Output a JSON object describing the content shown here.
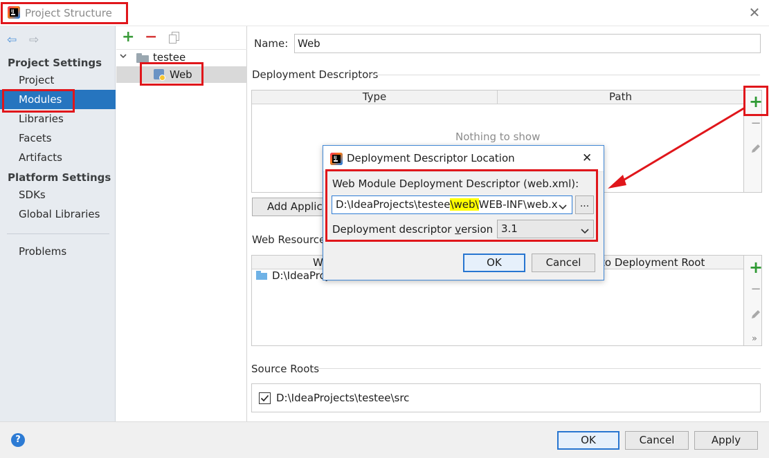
{
  "window": {
    "title": "Project Structure",
    "close_glyph": "✕"
  },
  "sidebar": {
    "back_glyph": "⇦",
    "forward_glyph": "⇨",
    "project_settings_header": "Project Settings",
    "items_project": [
      "Project",
      "Modules",
      "Libraries",
      "Facets",
      "Artifacts"
    ],
    "platform_settings_header": "Platform Settings",
    "items_platform": [
      "SDKs",
      "Global Libraries"
    ],
    "problems": "Problems",
    "selected": "Modules"
  },
  "tree": {
    "add_glyph": "+",
    "remove_glyph": "−",
    "root": "testee",
    "child": "Web"
  },
  "main": {
    "name_label": "Name:",
    "name_value": "Web",
    "deployment_descriptors_header": "Deployment Descriptors",
    "col_type": "Type",
    "col_path": "Path",
    "empty_text": "Nothing to show",
    "add_app_server_btn": "Add Applic",
    "web_resource_header": "Web Resource D",
    "web_resource_col_left": "W",
    "web_resource_col_right": "to Deployment Root",
    "web_resource_row": "D:\\IdeaProj",
    "more_glyph": "»",
    "source_roots_header": "Source Roots",
    "source_root_path": "D:\\IdeaProjects\\testee\\src",
    "source_root_checked": true
  },
  "dialog": {
    "title": "Deployment Descriptor Location",
    "close_glyph": "✕",
    "field_label": "Web Module Deployment Descriptor (web.xml):",
    "path_prefix": "D:\\IdeaProjects\\testee",
    "path_highlight": "\\web\\",
    "path_suffix": "WEB-INF\\web.x",
    "browse_label": "...",
    "version_label": "Deployment descriptor version",
    "version_value": "3.1",
    "ok": "OK",
    "cancel": "Cancel"
  },
  "footer": {
    "help_glyph": "?",
    "ok": "OK",
    "cancel": "Cancel",
    "apply": "Apply"
  },
  "colors": {
    "annotation_red": "#e0161b",
    "selection_blue": "#2675bf",
    "highlight_yellow": "#ffff00"
  }
}
